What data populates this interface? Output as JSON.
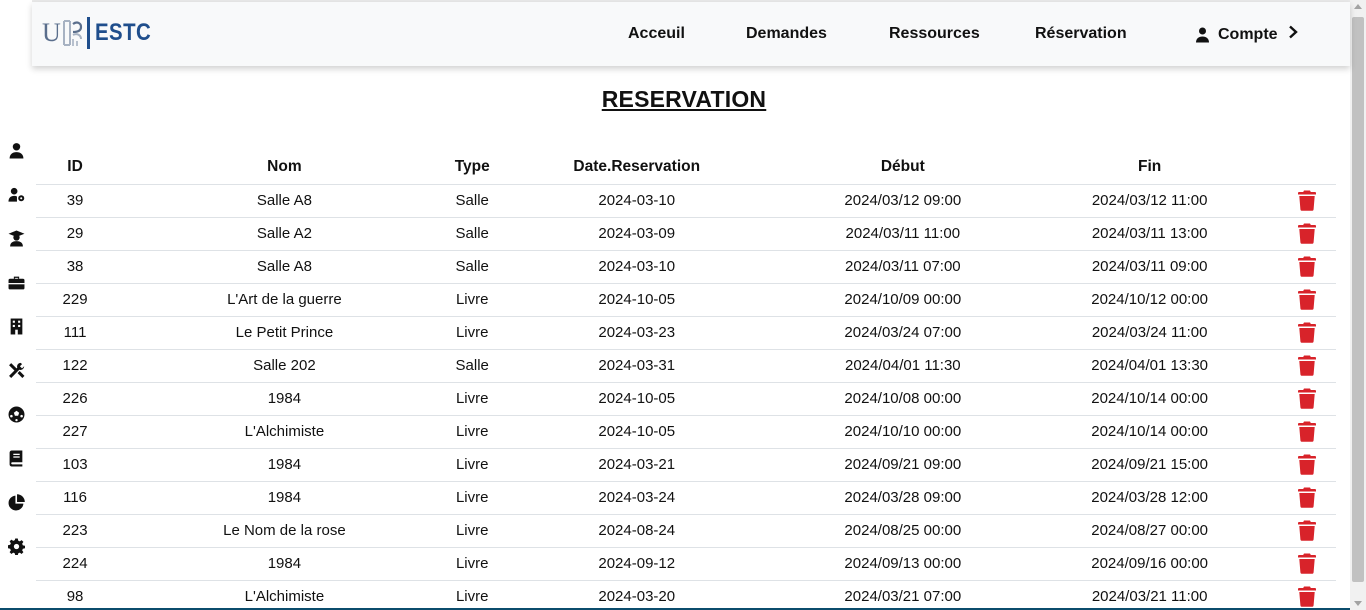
{
  "brand": {
    "logo_initial": "U",
    "logo_text": "ESTC"
  },
  "nav": {
    "acceuil": "Acceuil",
    "demandes": "Demandes",
    "ressources": "Ressources",
    "reservation": "Réservation",
    "compte": "Compte"
  },
  "sidebar": [
    "user-icon",
    "user-gear-icon",
    "graduate-icon",
    "briefcase-icon",
    "building-icon",
    "tools-icon",
    "soccer-ball-icon",
    "book-icon",
    "pie-chart-icon",
    "gear-icon"
  ],
  "page": {
    "title": "RESERVATION"
  },
  "table": {
    "headers": [
      "ID",
      "Nom",
      "Type",
      "Date.Reservation",
      "Début",
      "Fin"
    ],
    "rows": [
      [
        "39",
        "Salle A8",
        "Salle",
        "2024-03-10",
        "2024/03/12 09:00",
        "2024/03/12 11:00"
      ],
      [
        "29",
        "Salle A2",
        "Salle",
        "2024-03-09",
        "2024/03/11 11:00",
        "2024/03/11 13:00"
      ],
      [
        "38",
        "Salle A8",
        "Salle",
        "2024-03-10",
        "2024/03/11 07:00",
        "2024/03/11 09:00"
      ],
      [
        "229",
        "L'Art de la guerre",
        "Livre",
        "2024-10-05",
        "2024/10/09 00:00",
        "2024/10/12 00:00"
      ],
      [
        "111",
        "Le Petit Prince",
        "Livre",
        "2024-03-23",
        "2024/03/24 07:00",
        "2024/03/24 11:00"
      ],
      [
        "122",
        "Salle 202",
        "Salle",
        "2024-03-31",
        "2024/04/01 11:30",
        "2024/04/01 13:30"
      ],
      [
        "226",
        "1984",
        "Livre",
        "2024-10-05",
        "2024/10/08 00:00",
        "2024/10/14 00:00"
      ],
      [
        "227",
        "L'Alchimiste",
        "Livre",
        "2024-10-05",
        "2024/10/10 00:00",
        "2024/10/14 00:00"
      ],
      [
        "103",
        "1984",
        "Livre",
        "2024-03-21",
        "2024/09/21 09:00",
        "2024/09/21 15:00"
      ],
      [
        "116",
        "1984",
        "Livre",
        "2024-03-24",
        "2024/03/28 09:00",
        "2024/03/28 12:00"
      ],
      [
        "223",
        "Le Nom de la rose",
        "Livre",
        "2024-08-24",
        "2024/08/25 00:00",
        "2024/08/27 00:00"
      ],
      [
        "224",
        "1984",
        "Livre",
        "2024-09-12",
        "2024/09/13 00:00",
        "2024/09/16 00:00"
      ],
      [
        "98",
        "L'Alchimiste",
        "Livre",
        "2024-03-20",
        "2024/03/21 07:00",
        "2024/03/21 11:00"
      ]
    ]
  },
  "colors": {
    "delete": "#d8232a",
    "brand": "#1f4e8c",
    "navbar": "#f8f9fa"
  }
}
